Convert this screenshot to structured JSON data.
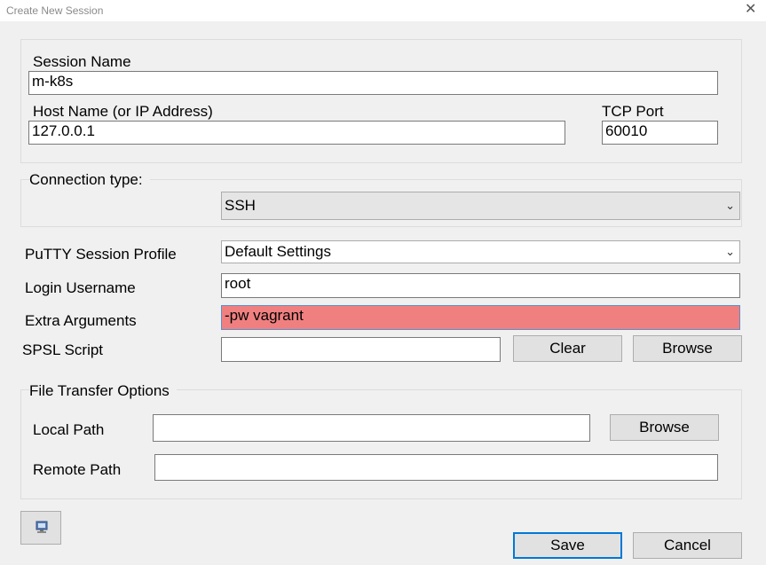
{
  "window": {
    "title": "Create New Session",
    "close_glyph": "✕"
  },
  "session": {
    "session_name_label": "Session Name",
    "session_name_value": "m-k8s",
    "host_label": "Host Name (or IP Address)",
    "host_value": "127.0.0.1",
    "port_label": "TCP Port",
    "port_value": "60010"
  },
  "connection": {
    "label": "Connection type:",
    "selected": "SSH"
  },
  "settings": {
    "profile_label": "PuTTY Session Profile",
    "profile_selected": "Default Settings",
    "username_label": "Login Username",
    "username_value": "root",
    "extra_label": "Extra Arguments",
    "extra_value": "-pw vagrant",
    "spsl_label": "SPSL Script",
    "spsl_value": "",
    "clear_label": "Clear",
    "browse_label": "Browse"
  },
  "file_transfer": {
    "group_label": "File Transfer Options",
    "local_label": "Local Path",
    "local_value": "",
    "browse_label": "Browse",
    "remote_label": "Remote Path",
    "remote_value": ""
  },
  "footer": {
    "save_label": "Save",
    "cancel_label": "Cancel"
  },
  "colors": {
    "extra_args_highlight": "#f08080",
    "save_border": "#0078d7"
  },
  "icons": {
    "bottom_left": "computer-icon",
    "dropdown": "chevron-down-icon"
  }
}
